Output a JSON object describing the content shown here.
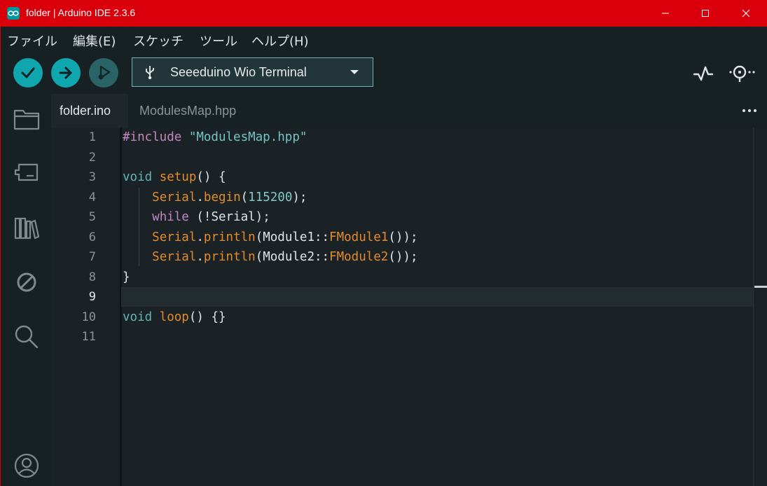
{
  "window": {
    "title": "folder | Arduino IDE 2.3.6"
  },
  "menu": [
    "ファイル",
    "編集(E)",
    "スケッチ",
    "ツール",
    "ヘルプ(H)"
  ],
  "toolbar": {
    "board": "Seeeduino Wio Terminal"
  },
  "tabs": [
    {
      "label": "folder.ino"
    },
    {
      "label": "ModulesMap.hpp"
    }
  ],
  "editor": {
    "line_numbers": [
      "1",
      "2",
      "3",
      "4",
      "5",
      "6",
      "7",
      "8",
      "9",
      "10",
      "11"
    ],
    "current_line": "9",
    "lines": [
      [
        {
          "t": "#include ",
          "c": "k-pink"
        },
        {
          "t": "\"ModulesMap.hpp\"",
          "c": "k-str"
        }
      ],
      [],
      [
        {
          "t": "void ",
          "c": "k-teal"
        },
        {
          "t": "setup",
          "c": "k-fn"
        },
        {
          "t": "() {",
          "c": "k-plain"
        }
      ],
      [
        {
          "t": "    ",
          "c": "k-plain"
        },
        {
          "t": "Serial",
          "c": "k-fn"
        },
        {
          "t": ".",
          "c": "k-plain"
        },
        {
          "t": "begin",
          "c": "k-fn"
        },
        {
          "t": "(",
          "c": "k-plain"
        },
        {
          "t": "115200",
          "c": "k-num"
        },
        {
          "t": ");",
          "c": "k-plain"
        }
      ],
      [
        {
          "t": "    ",
          "c": "k-plain"
        },
        {
          "t": "while",
          "c": "k-pink"
        },
        {
          "t": " (!Serial);",
          "c": "k-plain"
        }
      ],
      [
        {
          "t": "    ",
          "c": "k-plain"
        },
        {
          "t": "Serial",
          "c": "k-fn"
        },
        {
          "t": ".",
          "c": "k-plain"
        },
        {
          "t": "println",
          "c": "k-fn"
        },
        {
          "t": "(Module1::",
          "c": "k-plain"
        },
        {
          "t": "FModule1",
          "c": "k-fn"
        },
        {
          "t": "());",
          "c": "k-plain"
        }
      ],
      [
        {
          "t": "    ",
          "c": "k-plain"
        },
        {
          "t": "Serial",
          "c": "k-fn"
        },
        {
          "t": ".",
          "c": "k-plain"
        },
        {
          "t": "println",
          "c": "k-fn"
        },
        {
          "t": "(Module2::",
          "c": "k-plain"
        },
        {
          "t": "FModule2",
          "c": "k-fn"
        },
        {
          "t": "());",
          "c": "k-plain"
        }
      ],
      [
        {
          "t": "}",
          "c": "k-plain"
        }
      ],
      [],
      [
        {
          "t": "void ",
          "c": "k-teal"
        },
        {
          "t": "loop",
          "c": "k-fn"
        },
        {
          "t": "() {}",
          "c": "k-plain"
        }
      ],
      []
    ]
  },
  "icons": {
    "app": "arduino-icon",
    "verify": "check-icon",
    "upload": "arrow-right-icon",
    "debug": "debug-icon",
    "usb": "usb-icon",
    "dropdown": "caret-down-icon",
    "serial_plotter": "plotter-icon",
    "serial_monitor": "serial-monitor-icon",
    "more": "ellipsis-icon",
    "sidebar": [
      "folder-icon",
      "board-manager-icon",
      "library-icon",
      "debug-off-icon",
      "search-icon",
      "account-icon"
    ]
  },
  "colors": {
    "titlebar": "#d9000b",
    "accent": "#00979d",
    "background": "#1f272a"
  }
}
